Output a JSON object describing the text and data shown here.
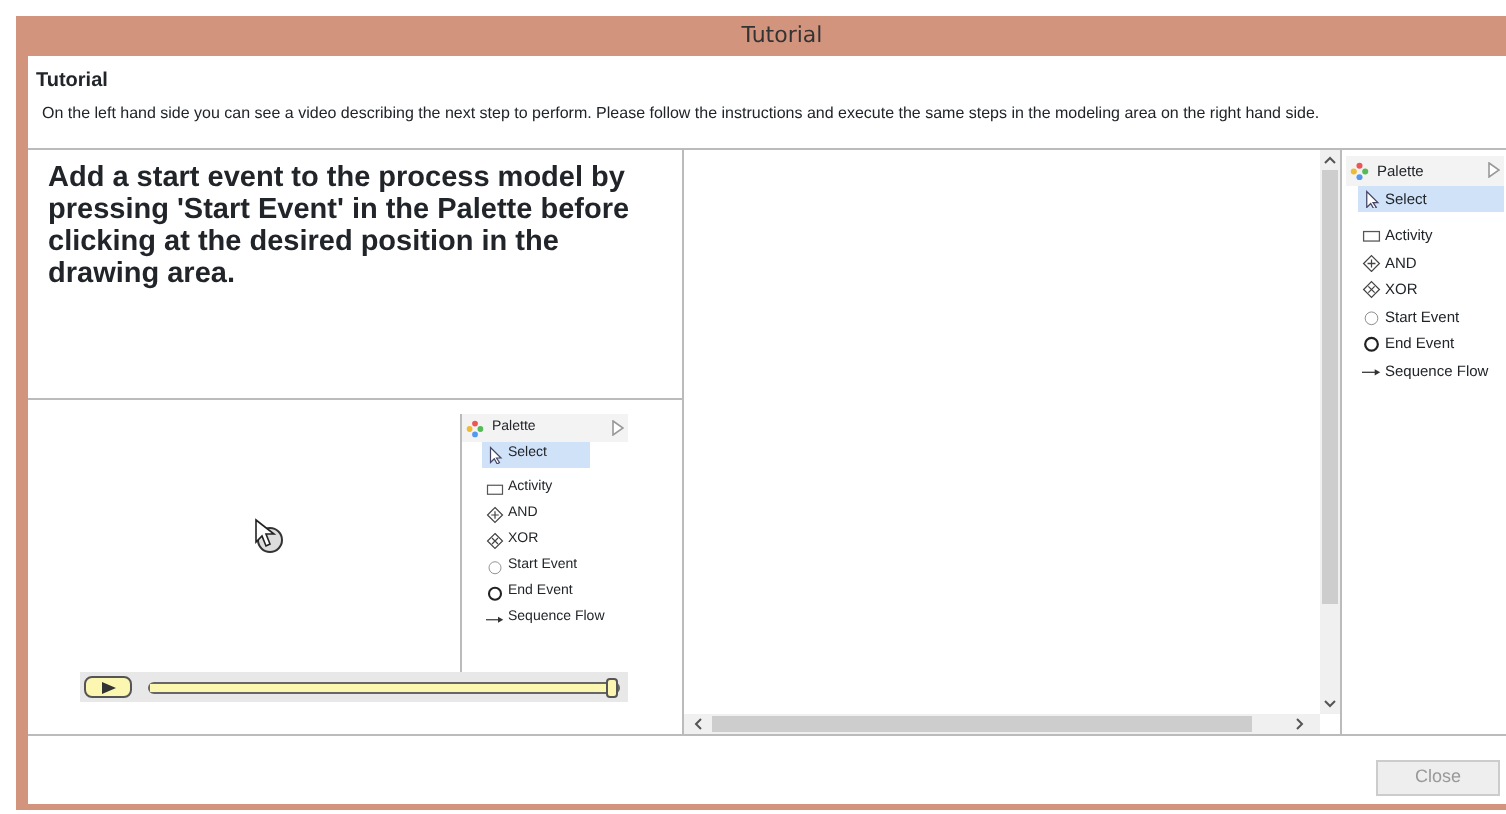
{
  "window": {
    "title": "Tutorial"
  },
  "header": {
    "title": "Tutorial",
    "description": "On the left hand side you can see a video describing the next step to perform. Please follow the instructions and execute the same steps in the modeling area on the right hand side."
  },
  "instruction": "Add a start event to the process model by pressing 'Start Event' in the Palette before clicking at the desired position in the drawing area.",
  "video": {
    "palette": {
      "title": "Palette",
      "items": [
        {
          "label": "Select",
          "kind": "select",
          "selected": true
        },
        {
          "label": "Activity",
          "kind": "activity",
          "selected": false
        },
        {
          "label": "AND",
          "kind": "and",
          "selected": false
        },
        {
          "label": "XOR",
          "kind": "xor",
          "selected": false
        },
        {
          "label": "Start Event",
          "kind": "start",
          "selected": false
        },
        {
          "label": "End Event",
          "kind": "end",
          "selected": false
        },
        {
          "label": "Sequence Flow",
          "kind": "flow",
          "selected": false
        }
      ]
    },
    "player": {
      "level": 1
    }
  },
  "modeling_area": {
    "palette": {
      "title": "Palette",
      "items": [
        {
          "label": "Select",
          "kind": "select",
          "selected": true
        },
        {
          "label": "Activity",
          "kind": "activity",
          "selected": false
        },
        {
          "label": "AND",
          "kind": "and",
          "selected": false
        },
        {
          "label": "XOR",
          "kind": "xor",
          "selected": false
        },
        {
          "label": "Start Event",
          "kind": "start",
          "selected": false
        },
        {
          "label": "End Event",
          "kind": "end",
          "selected": false
        },
        {
          "label": "Sequence Flow",
          "kind": "flow",
          "selected": false
        }
      ]
    }
  },
  "close_button": {
    "label": "Close",
    "disabled": true
  }
}
